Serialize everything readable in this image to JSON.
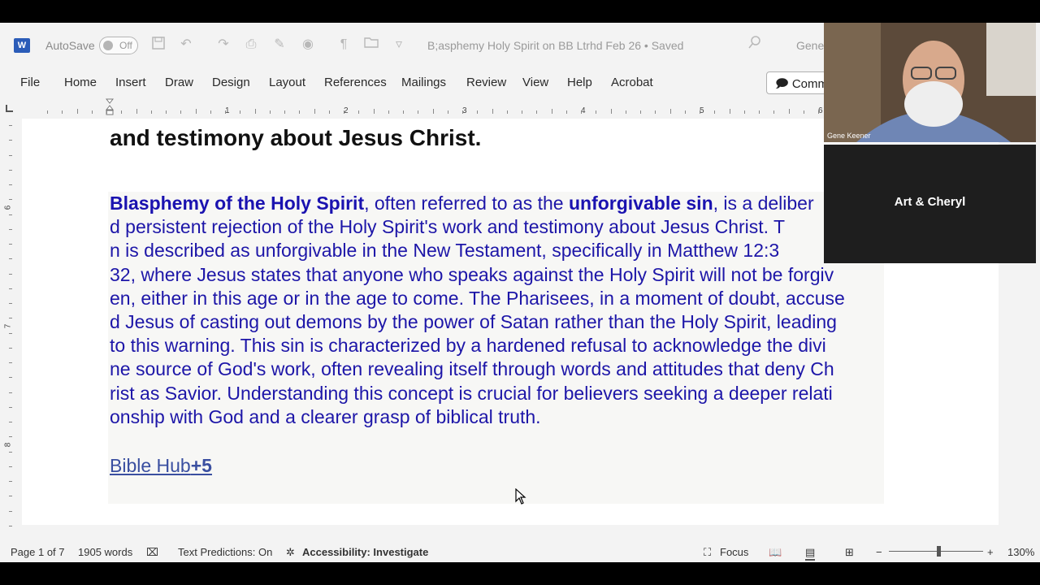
{
  "titlebar": {
    "app_icon": "W",
    "autosave_label": "AutoSave",
    "autosave_state": "Off",
    "doc_title": "B;asphemy Holy Spirit on BB Ltrhd Feb 26 • Saved",
    "user_name": "Gene"
  },
  "ribbon": {
    "tabs": [
      "File",
      "Home",
      "Insert",
      "Draw",
      "Design",
      "Layout",
      "References",
      "Mailings",
      "Review",
      "View",
      "Help",
      "Acrobat"
    ],
    "comments_label": "Comm"
  },
  "ruler": {
    "numbers": [
      "1",
      "2",
      "3",
      "4",
      "5",
      "6"
    ],
    "vertical_numbers": [
      "6",
      "7",
      "8"
    ]
  },
  "document": {
    "heading": "and testimony about Jesus Christ.",
    "para_bold1": "Blasphemy of the Holy Spirit",
    "para_mid1": ", often referred to as the ",
    "para_bold2": "unforgivable sin",
    "para_line1_end": ", is a deliber",
    "para_lines": [
      "d persistent rejection of the Holy Spirit's work and testimony about Jesus Christ. T",
      "n is described as unforgivable in the New Testament, specifically in Matthew 12:3",
      "32, where Jesus states that anyone who speaks against the Holy Spirit will not be forgiv",
      "en, either in this age or in the age to come. The Pharisees, in a moment of doubt, accuse",
      "d Jesus of casting out demons by the power of Satan rather than the Holy Spirit, leading",
      " to this warning. This sin is characterized by a hardened refusal to acknowledge the divi",
      "ne source of God's work, often revealing itself through words and attitudes that deny Ch",
      "rist as Savior. Understanding this concept is crucial for believers seeking a deeper relati",
      "onship with God and a clearer grasp of biblical truth."
    ],
    "source_label": "Bible Hub",
    "source_count": "+5"
  },
  "statusbar": {
    "page": "Page 1 of 7",
    "words": "1905 words",
    "predictions": "Text Predictions: On",
    "accessibility": "Accessibility: Investigate",
    "focus": "Focus",
    "zoom": "130%"
  },
  "video": {
    "main_name": "Gene Keener",
    "tile2_name": "Art & Cheryl"
  },
  "colors": {
    "paragraph_text": "#1d16a8",
    "link": "#3a4fa0",
    "word_brand": "#2b5cb8"
  }
}
